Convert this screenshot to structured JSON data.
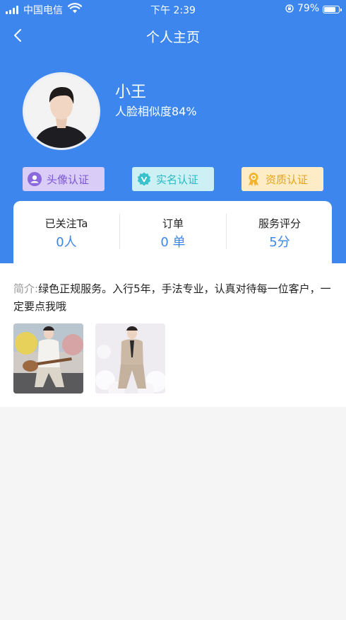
{
  "status_bar": {
    "carrier": "中国电信",
    "time": "下午 2:39",
    "battery": "79%"
  },
  "nav": {
    "title": "个人主页",
    "back_icon": "chevron-left-icon"
  },
  "profile": {
    "name": "小王",
    "similarity": "人脸相似度84%"
  },
  "certifications": [
    {
      "label": "头像认证",
      "icon": "user-circle-icon",
      "color": "#7a56d4"
    },
    {
      "label": "实名认证",
      "icon": "verified-badge-icon",
      "color": "#2cb9c4"
    },
    {
      "label": "资质认证",
      "icon": "award-ribbon-icon",
      "color": "#e6a218"
    }
  ],
  "stats": [
    {
      "label": "已关注Ta",
      "value": "0人"
    },
    {
      "label": "订单",
      "value": "0 单"
    },
    {
      "label": "服务评分",
      "value": "5分"
    }
  ],
  "intro": {
    "prefix": "简介:",
    "text": "绿色正规服务。入行5年，手法专业，认真对待每一位客户，一定要点我哦"
  },
  "colors": {
    "primary": "#3d86ee",
    "page_background": "#f5f5f5"
  }
}
